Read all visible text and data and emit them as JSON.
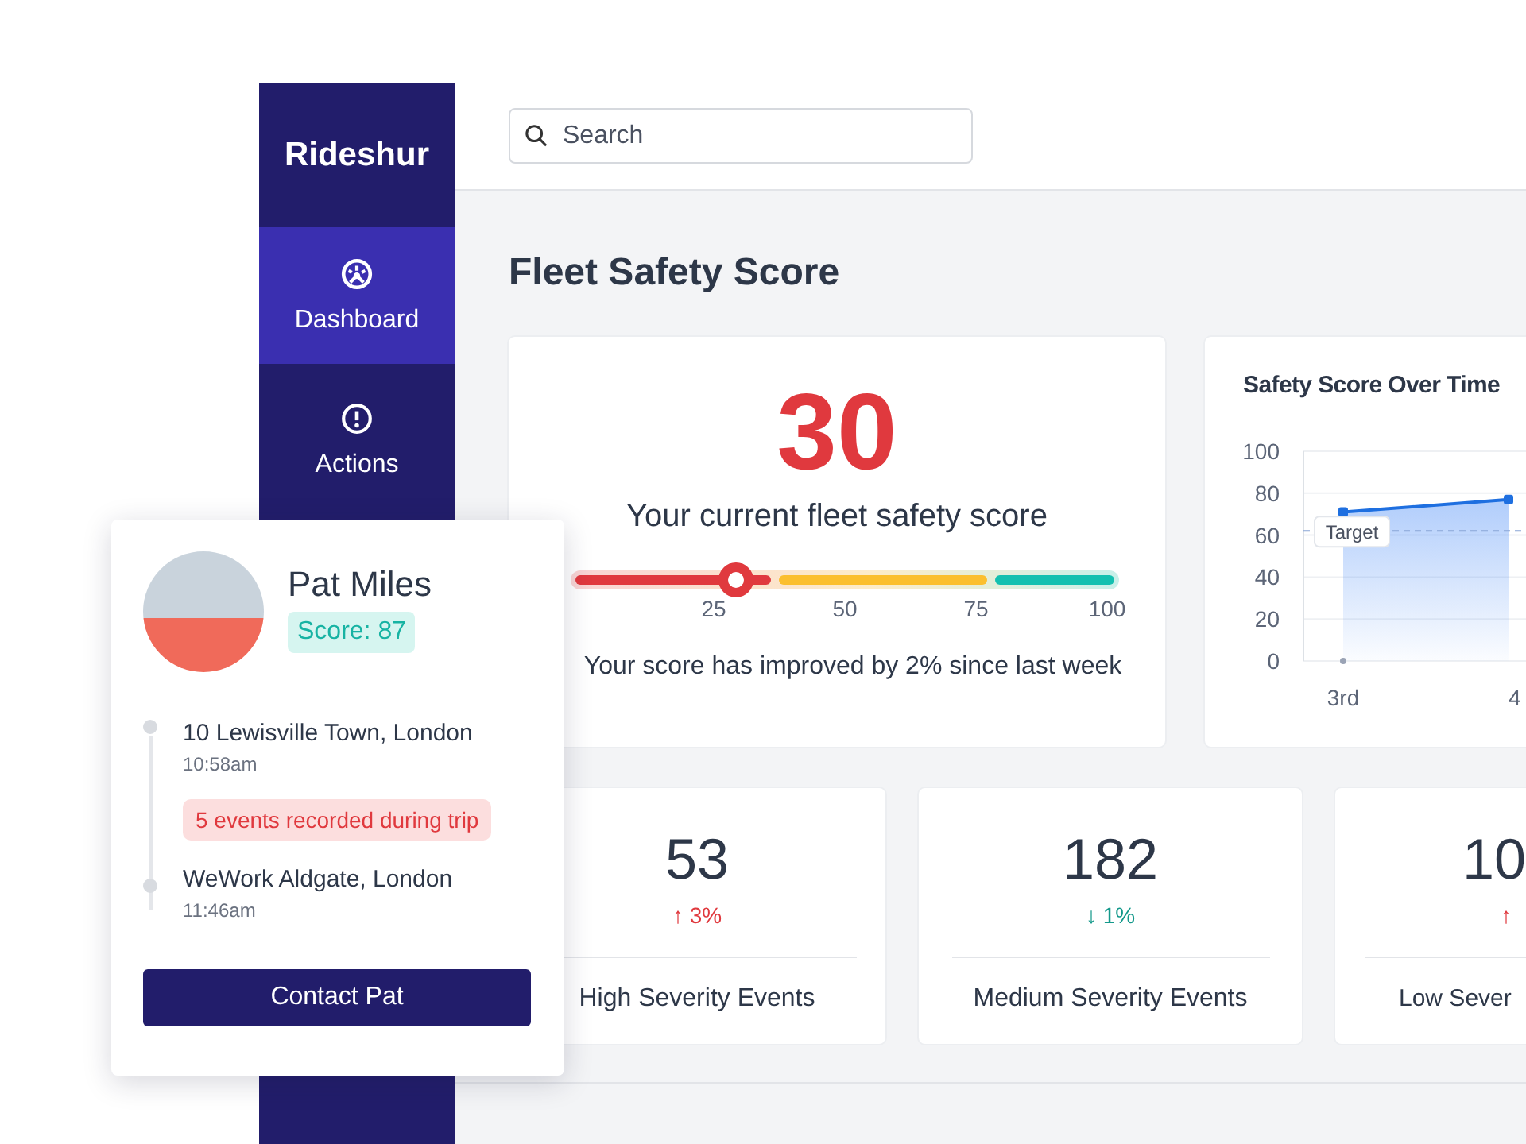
{
  "sidebar": {
    "logo": "Rideshur",
    "items": [
      {
        "label": "Dashboard",
        "selected": true
      },
      {
        "label": "Actions",
        "selected": false
      }
    ]
  },
  "search": {
    "placeholder": "Search"
  },
  "page_title": "Fleet Safety Score",
  "score": {
    "value": "30",
    "caption": "Your current fleet safety score",
    "level": 0.3,
    "scale_labels": [
      "25",
      "50",
      "75",
      "100"
    ],
    "note": "Your score has improved by 2% since last week"
  },
  "chart": {
    "title": "Safety Score Over Time",
    "chart_data": {
      "type": "area",
      "categories": [
        "3rd",
        "4"
      ],
      "values": [
        71,
        77
      ],
      "ylim": [
        0,
        100
      ],
      "yticks": [
        0,
        20,
        40,
        60,
        80,
        100
      ],
      "grid": true,
      "ref_lines": [
        {
          "axis": "y",
          "value": 62,
          "label": "Target"
        }
      ]
    }
  },
  "stats": [
    {
      "value": "53",
      "change": "↑ 3%",
      "color": "#e0393e",
      "label": "High Severity Events"
    },
    {
      "value": "182",
      "change": "↓ 1%",
      "color": "#14998b",
      "label": "Medium Severity Events"
    },
    {
      "value": "10",
      "change": "↑",
      "color": "#e0393e",
      "label": "Low Sever"
    }
  ],
  "driver": {
    "name": "Pat Miles",
    "score": "Score: 87",
    "stops": [
      {
        "kind": "place",
        "place": "10 Lewisville Town, London",
        "time": "10:58am"
      },
      {
        "kind": "events",
        "text": "5 events recorded during trip"
      },
      {
        "kind": "place",
        "place": "WeWork Aldgate, London",
        "time": "11:46am"
      }
    ],
    "button": "Contact Pat"
  }
}
